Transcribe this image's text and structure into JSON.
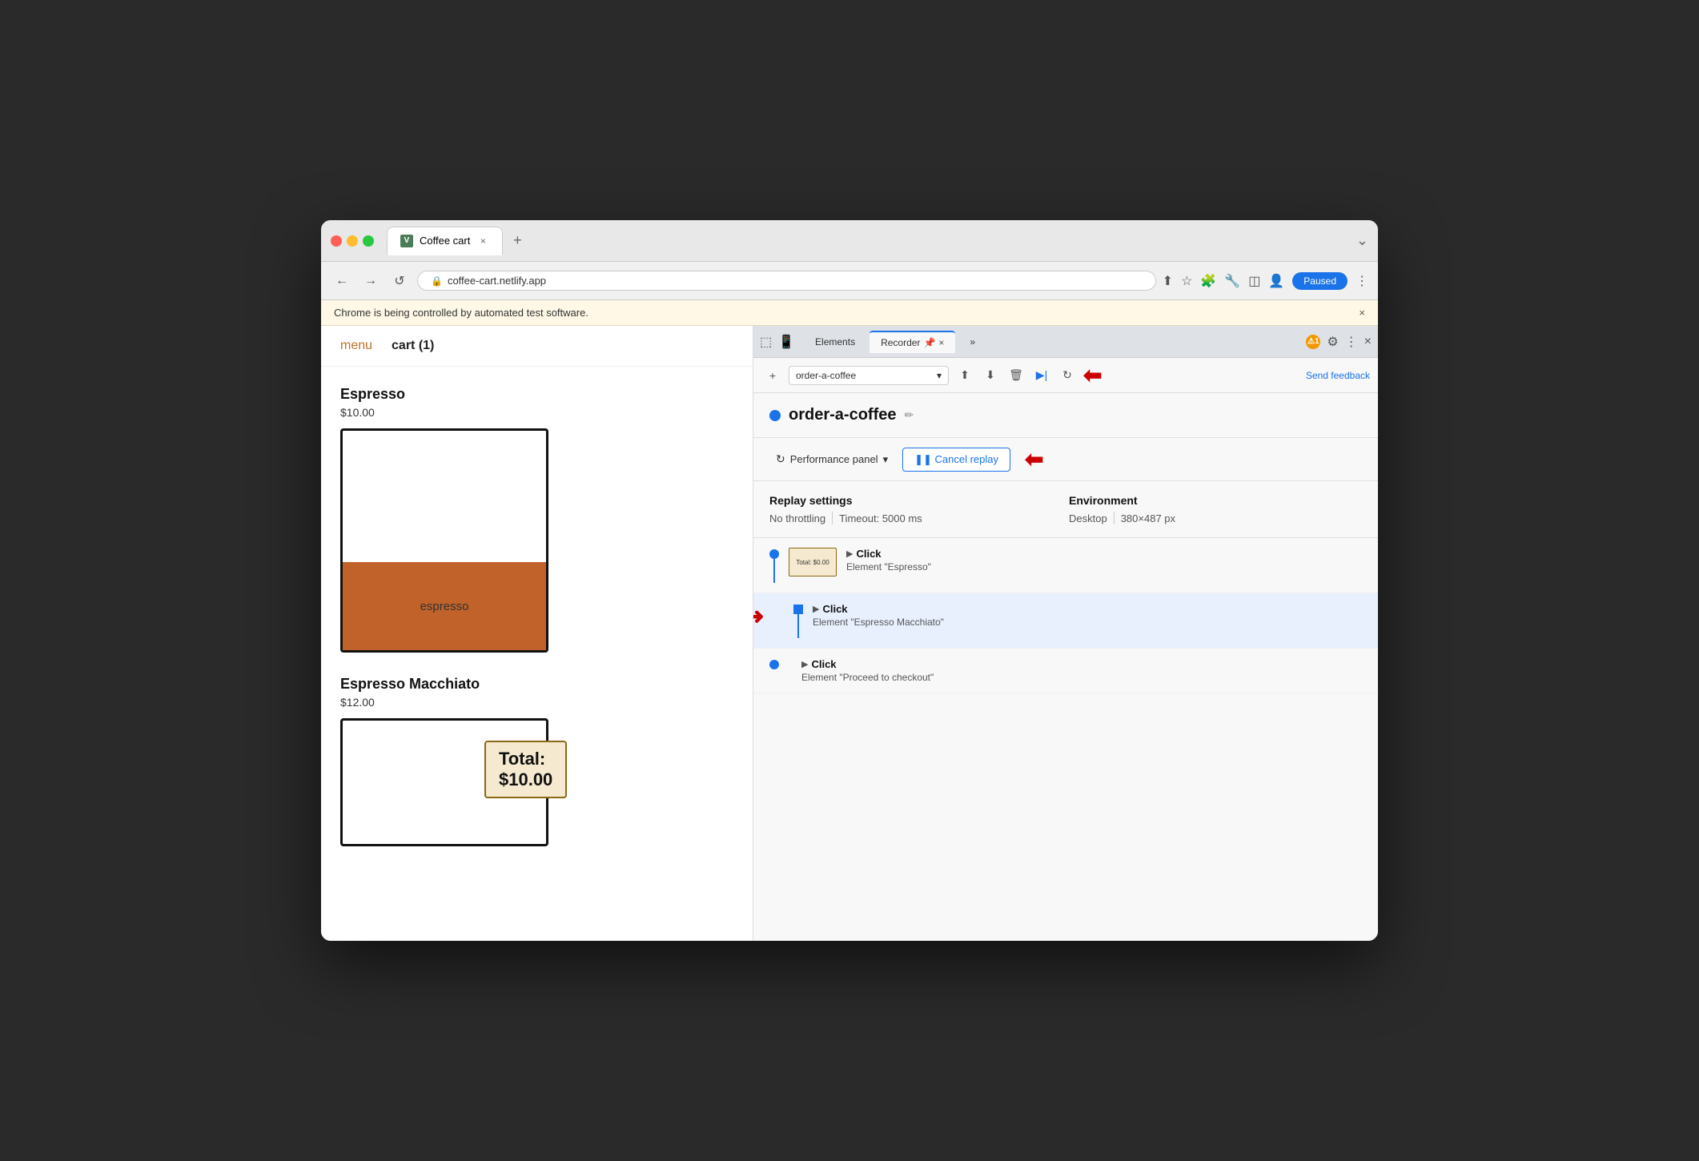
{
  "browser": {
    "tab": {
      "title": "Coffee cart",
      "favicon_label": "V",
      "close_label": "×",
      "new_tab_label": "+"
    },
    "address": "coffee-cart.netlify.app",
    "nav": {
      "back": "←",
      "forward": "→",
      "reload": "↺"
    },
    "controls": {
      "paused": "Paused",
      "more": "⋮",
      "chevron": "⌄"
    },
    "automation_banner": "Chrome is being controlled by automated test software.",
    "automation_close": "×"
  },
  "coffee_page": {
    "nav": {
      "menu": "menu",
      "cart": "cart (1)"
    },
    "items": [
      {
        "name": "Espresso",
        "price": "$10.00",
        "liquid_label": "espresso",
        "has_cup": true
      },
      {
        "name": "Espresso Macchiato",
        "price": "$12.00",
        "has_cup": true
      }
    ],
    "total": "Total: $10.00"
  },
  "devtools": {
    "tabs": [
      {
        "label": "Elements",
        "active": false
      },
      {
        "label": "Recorder 📌",
        "active": true
      },
      {
        "label": "»",
        "active": false
      }
    ],
    "toolbar": {
      "add_icon": "+",
      "recording_name": "order-a-coffee",
      "dropdown": "▾",
      "send_feedback": "Send feedback"
    },
    "notification": {
      "count": "1",
      "icon": "⚠"
    },
    "controls": {
      "gear": "⚙",
      "more": "⋮",
      "close": "×"
    },
    "recording": {
      "dot_color": "#1a73e8",
      "title": "order-a-coffee",
      "edit_icon": "✏"
    },
    "performance": {
      "icon": "↻",
      "label": "Performance panel",
      "dropdown": "▾",
      "cancel_replay_label": "❚❚ Cancel replay"
    },
    "settings": {
      "replay_label": "Replay settings",
      "throttling": "No throttling",
      "timeout": "Timeout: 5000 ms",
      "env_label": "Environment",
      "desktop": "Desktop",
      "resolution": "380×487 px"
    },
    "steps": [
      {
        "action": "Click",
        "element": "Element \"Espresso\"",
        "active": false,
        "has_thumbnail": true,
        "thumbnail_text": "Total: $0.00"
      },
      {
        "action": "Click",
        "element": "Element \"Espresso Macchiato\"",
        "active": true,
        "has_thumbnail": false
      },
      {
        "action": "Click",
        "element": "Element \"Proceed to checkout\"",
        "active": false,
        "has_thumbnail": false
      }
    ]
  }
}
